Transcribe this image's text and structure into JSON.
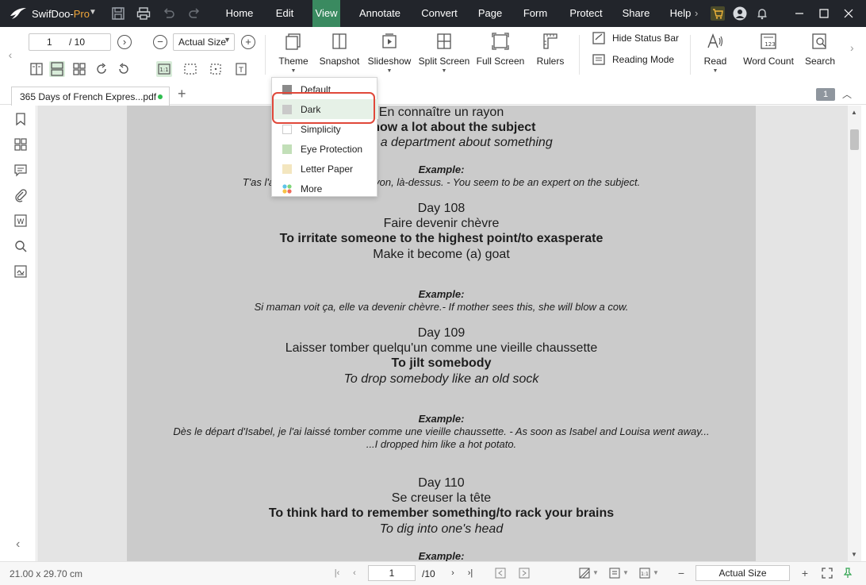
{
  "app": {
    "name": "SwifDoo-",
    "name_suffix": "Pro"
  },
  "menubar": {
    "items": [
      {
        "label": "Home",
        "active": false
      },
      {
        "label": "Edit",
        "active": false
      },
      {
        "label": "View",
        "active": true
      },
      {
        "label": "Annotate",
        "active": false
      },
      {
        "label": "Convert",
        "active": false
      },
      {
        "label": "Page",
        "active": false
      },
      {
        "label": "Form",
        "active": false
      },
      {
        "label": "Protect",
        "active": false
      },
      {
        "label": "Share",
        "active": false
      },
      {
        "label": "Help",
        "active": false
      }
    ]
  },
  "toolbar": {
    "page_current": "1",
    "page_total": "/ 10",
    "zoom": "Actual Size",
    "tools": {
      "theme": "Theme",
      "snapshot": "Snapshot",
      "slideshow": "Slideshow",
      "split_screen": "Split Screen",
      "full_screen": "Full Screen",
      "rulers": "Rulers",
      "hide_status_bar": "Hide Status Bar",
      "reading_mode": "Reading Mode",
      "read": "Read",
      "word_count": "Word Count",
      "search": "Search"
    }
  },
  "theme_menu": {
    "items": [
      {
        "label": "Default",
        "swatch": "#8a8a8a"
      },
      {
        "label": "Dark",
        "swatch": "#c9c9c9"
      },
      {
        "label": "Simplicity",
        "swatch": "#ffffff"
      },
      {
        "label": "Eye Protection",
        "swatch": "#c2dfb8"
      },
      {
        "label": "Letter Paper",
        "swatch": "#f3e6bf"
      },
      {
        "label": "More",
        "swatch": "multi"
      }
    ],
    "highlighted": "Dark"
  },
  "tabs": {
    "document": "365 Days of French Expres...pdf",
    "page_badge": "1"
  },
  "document": {
    "lines": [
      {
        "text": "En connaître un rayon",
        "style": "l16"
      },
      {
        "text": "To know a lot about the subject",
        "style": "b16"
      },
      {
        "text": "To know a department about something",
        "style": "i16"
      },
      {
        "text": "Example:",
        "style": "ex"
      },
      {
        "text": "T'as l'air d'en connaître un rayon, là-dessus. - You seem to be an expert on the subject.",
        "style": "s13"
      },
      {
        "text": "Day 108",
        "style": "l16"
      },
      {
        "text": "Faire devenir chèvre",
        "style": "l16"
      },
      {
        "text": "To irritate someone to the highest point/to exasperate",
        "style": "b16"
      },
      {
        "text": "Make it become (a) goat",
        "style": "l16"
      },
      {
        "text": "Example:",
        "style": "ex"
      },
      {
        "text": "Si maman voit ça, elle va devenir chèvre.- If mother sees this, she will blow a cow.",
        "style": "s13"
      },
      {
        "text": "Day 109",
        "style": "l16"
      },
      {
        "text": "Laisser tomber quelqu'un comme une vieille chaussette",
        "style": "l16"
      },
      {
        "text": "To jilt somebody",
        "style": "b16"
      },
      {
        "text": "To drop somebody like an old sock",
        "style": "i16"
      },
      {
        "text": "Example:",
        "style": "ex"
      },
      {
        "text": "Dès le départ d'Isabel, je l'ai laissé tomber comme une vieille chaussette. - As soon as Isabel and Louisa went away...",
        "style": "s13"
      },
      {
        "text": "...I dropped him like a hot potato.",
        "style": "s13"
      },
      {
        "text": "Day 110",
        "style": "l16"
      },
      {
        "text": "Se creuser la tête",
        "style": "l16"
      },
      {
        "text": "To think hard to remember something/to rack your brains",
        "style": "b16"
      },
      {
        "text": "To dig into one's head",
        "style": "i16"
      },
      {
        "text": "Example:",
        "style": "ex"
      }
    ]
  },
  "statusbar": {
    "dimensions": "21.00 x 29.70 cm",
    "page_current": "1",
    "page_total": "/10",
    "zoom": "Actual Size"
  },
  "colors": {
    "titlebar": "#22252b",
    "active_menu": "#3a8a60",
    "highlight_outline": "#e0483a",
    "page_background": "#cbcbcb"
  }
}
